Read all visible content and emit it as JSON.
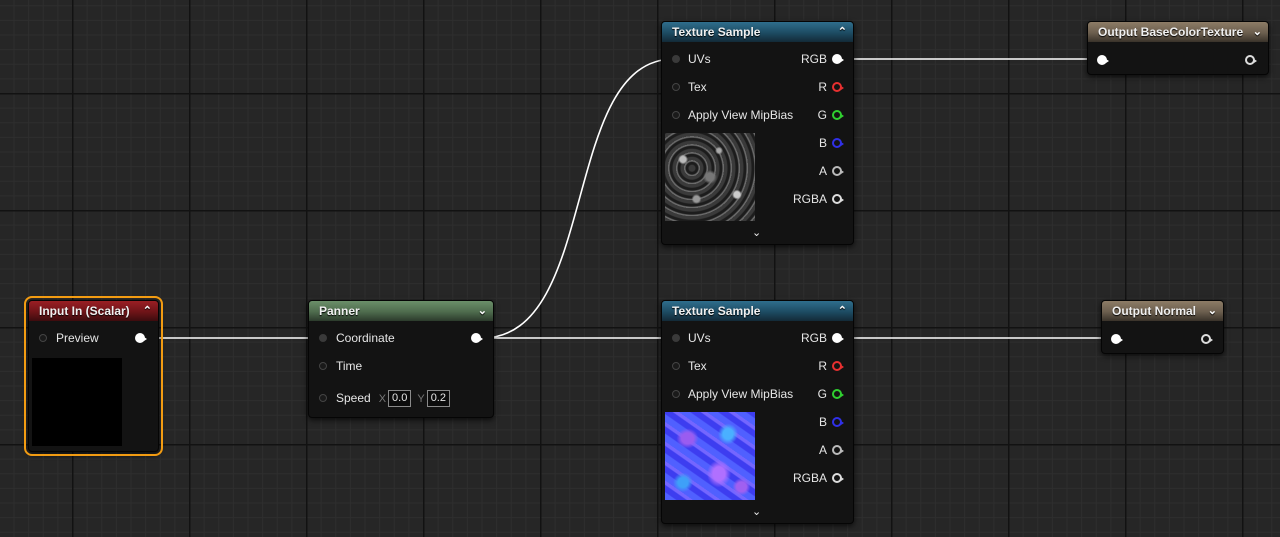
{
  "colors": {
    "texture_header": "#1d4b62",
    "input_header": "#6e1418",
    "panner_header": "#4e6b4d",
    "output_header": "#6b5e4e",
    "selection": "#f39c12",
    "wire": "#ffffff"
  },
  "nodes": {
    "input": {
      "title": "Input In (Scalar)",
      "preview_label": "Preview"
    },
    "panner": {
      "title": "Panner",
      "coordinate_label": "Coordinate",
      "time_label": "Time",
      "speed_label": "Speed",
      "speed_x_axis": "X",
      "speed_x": "0.0",
      "speed_y_axis": "Y",
      "speed_y": "0.2"
    },
    "texture_top": {
      "title": "Texture Sample",
      "inputs": [
        "UVs",
        "Tex",
        "Apply View MipBias"
      ],
      "outputs": [
        "RGB",
        "R",
        "G",
        "B",
        "A",
        "RGBA"
      ]
    },
    "texture_bottom": {
      "title": "Texture Sample",
      "inputs": [
        "UVs",
        "Tex",
        "Apply View MipBias"
      ],
      "outputs": [
        "RGB",
        "R",
        "G",
        "B",
        "A",
        "RGBA"
      ]
    },
    "output_base": {
      "title": "Output BaseColorTexture"
    },
    "output_normal": {
      "title": "Output Normal"
    }
  },
  "icons": {
    "collapse_up": "▲",
    "collapse_down": "▼",
    "expand_chevron": "chevron-down-icon"
  }
}
